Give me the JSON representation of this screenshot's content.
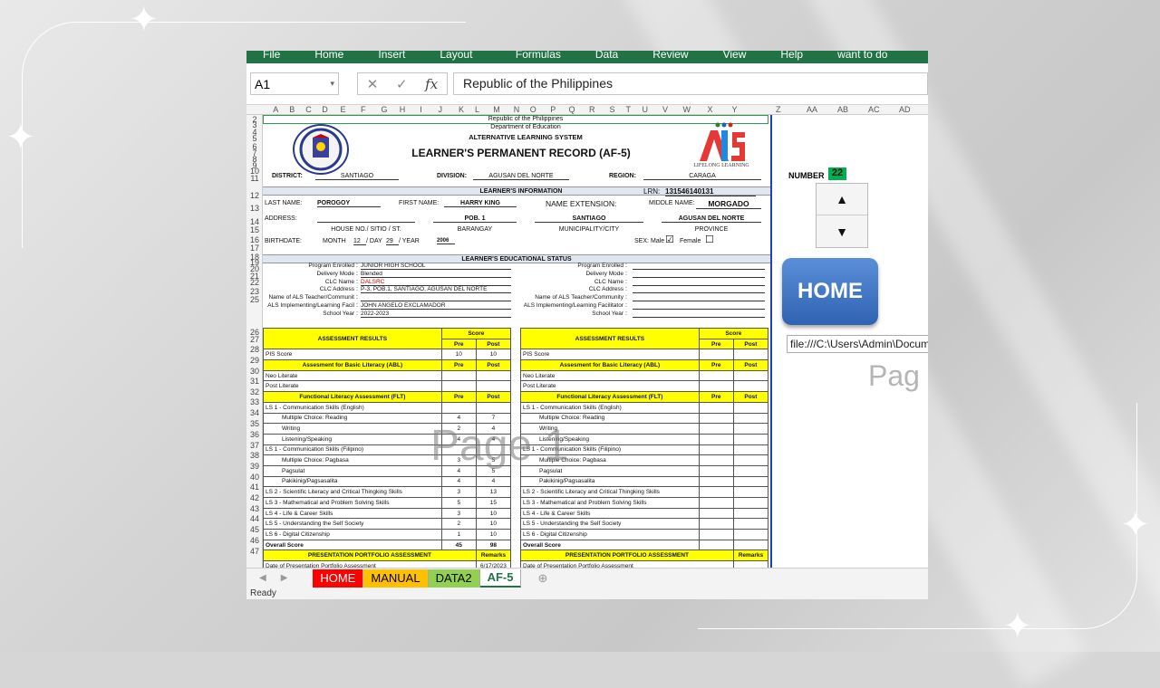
{
  "ribbon": {
    "tabs": [
      "File",
      "Home",
      "Insert",
      "Page Layout",
      "Formulas",
      "Data",
      "Review",
      "View",
      "Help",
      "Tell me what you want to do"
    ]
  },
  "formula_bar": {
    "name_box": "A1",
    "fx": "fx",
    "content": "Republic of the Philippines"
  },
  "columns": [
    "A",
    "B",
    "C",
    "D",
    "E",
    "F",
    "G",
    "H",
    "I",
    "J",
    "K",
    "L",
    "M",
    "N",
    "O",
    "P",
    "Q",
    "R",
    "S",
    "T",
    "U",
    "V",
    "W",
    "X",
    "Y",
    "Z",
    "AA",
    "AB",
    "AC",
    "AD",
    "AE"
  ],
  "rows": [
    "2",
    "3",
    "4",
    "5",
    "6",
    "7",
    "8",
    "9",
    "10",
    "11",
    "12",
    "13",
    "14",
    "15",
    "16",
    "17",
    "18",
    "19",
    "20",
    "21",
    "22",
    "23",
    "25",
    "26",
    "27",
    "28",
    "29",
    "30",
    "31",
    "32",
    "33",
    "34",
    "35",
    "36",
    "37",
    "38",
    "39",
    "40",
    "41",
    "42",
    "43",
    "44",
    "45",
    "46",
    "47"
  ],
  "header": {
    "republic": "Republic of the Philippines",
    "department": "Department of Education",
    "system": "ALTERNATIVE LEARNING SYSTEM",
    "title": "LEARNER'S PERMANENT RECORD (AF-5)",
    "als_logo": "ALS",
    "als_tagline": "LIFELONG LEARNING",
    "district_label": "DISTRICT:",
    "district": "SANTIAGO",
    "division_label": "DIVISION:",
    "division": "AGUSAN DEL NORTE",
    "region_label": "REGION:",
    "region": "CARAGA"
  },
  "learner_info": {
    "heading": "LEARNER'S INFORMATION",
    "lrn_label": "LRN:",
    "lrn": "131546140131",
    "last_name_label": "LAST NAME:",
    "last_name": "POROGOY",
    "first_name_label": "FIRST NAME:",
    "first_name": "HARRY KING",
    "ext_label": "NAME EXTENSION:",
    "middle_label": "MIDDLE NAME:",
    "middle_name": "MORGADO",
    "address_label": "ADDRESS:",
    "barangay": "POB. 1",
    "municipality": "SANTIAGO",
    "province": "AGUSAN DEL NORTE",
    "house_caption": "HOUSE NO./ SITIO / ST.",
    "barangay_caption": "BARANGAY",
    "municipality_caption": "MUNICIPALITY/CITY",
    "province_caption": "PROVINCE",
    "birthdate_label": "BIRTHDATE:",
    "month_label": "MONTH",
    "month": "12",
    "day_label": "/ DAY",
    "day": "29",
    "year_label": "/ YEAR",
    "year": "2006",
    "sex_label": "SEX:",
    "male_label": "Male",
    "female_label": "Female",
    "male_check": "☑",
    "female_check": "☐"
  },
  "educational_status": {
    "heading": "LEARNER'S EDUCATIONAL STATUS",
    "left": [
      {
        "label": "Program Enrolled",
        "value": "JUNIOR HIGH SCHOOL"
      },
      {
        "label": "Delivery Mode",
        "value": "Blended"
      },
      {
        "label": "CLC Name",
        "value": "DALSRC"
      },
      {
        "label": "CLC Address",
        "value": "P-3, POB.1, SANTIAGO, AGUSAN DEL NORTE"
      },
      {
        "label": "Name of ALS Teacher/Communit",
        "value": ""
      },
      {
        "label": "ALS Implementing/Learning Facil",
        "value": "JOHN ANGELO EXCLAMADOR"
      },
      {
        "label": "School Year",
        "value": "2022-2023"
      }
    ],
    "right": [
      {
        "label": "Program Enrolled",
        "value": ""
      },
      {
        "label": "Delivery Mode",
        "value": ""
      },
      {
        "label": "CLC Name",
        "value": ""
      },
      {
        "label": "CLC Address",
        "value": ""
      },
      {
        "label": "Name of ALS Teacher/Community",
        "value": ""
      },
      {
        "label": "ALS Implementing/Learning Facilitator",
        "value": ""
      },
      {
        "label": "School Year",
        "value": ""
      }
    ]
  },
  "assessment": {
    "heading": "ASSESSMENT RESULTS",
    "score": "Score",
    "pre": "Pre",
    "post": "Post",
    "left_rows": [
      {
        "label": "PIS Score",
        "pre": "10",
        "post": "10",
        "style": "plain"
      },
      {
        "label": "Assesment for Basic Literacy (ABL)",
        "pre": "Pre",
        "post": "Post",
        "style": "yellow"
      },
      {
        "label": "Neo Literate",
        "pre": "",
        "post": "",
        "style": "plain"
      },
      {
        "label": "Post Literate",
        "pre": "",
        "post": "",
        "style": "plain"
      },
      {
        "label": "Functional Literacy Assessment (FLT)",
        "pre": "Pre",
        "post": "Post",
        "style": "yellow"
      },
      {
        "label": "LS 1 - Communication Skills (English)",
        "pre": "",
        "post": "",
        "style": "plain"
      },
      {
        "label": "Multiple Choice: Reading",
        "pre": "4",
        "post": "7",
        "style": "indent"
      },
      {
        "label": "Writing",
        "pre": "2",
        "post": "4",
        "style": "indent"
      },
      {
        "label": "Listening/Speaking",
        "pre": "4",
        "post": "4",
        "style": "indent"
      },
      {
        "label": "LS 1 - Communication Skills (Filipino)",
        "pre": "",
        "post": "",
        "style": "plain"
      },
      {
        "label": "Multiple Choice: Pagbasa",
        "pre": "3",
        "post": "5",
        "style": "indent"
      },
      {
        "label": "Pagsulat",
        "pre": "4",
        "post": "5",
        "style": "indent"
      },
      {
        "label": "Pakikinig/Pagsasalita",
        "pre": "4",
        "post": "4",
        "style": "indent"
      },
      {
        "label": "LS 2 - Scientific Literacy and Critical Thingking Skills",
        "pre": "3",
        "post": "13",
        "style": "plain"
      },
      {
        "label": "LS 3 - Mathematical and Problem Solving Skills",
        "pre": "5",
        "post": "15",
        "style": "plain"
      },
      {
        "label": "LS 4 - Life & Career Skills",
        "pre": "3",
        "post": "10",
        "style": "plain"
      },
      {
        "label": "LS 5 - Understanding the Self Society",
        "pre": "2",
        "post": "10",
        "style": "plain"
      },
      {
        "label": "LS 6 - Digital Citizenship",
        "pre": "1",
        "post": "10",
        "style": "plain"
      },
      {
        "label": "Overall Score",
        "pre": "45",
        "post": "98",
        "style": "bold"
      },
      {
        "label": "PRESENTATION PORTFOLIO ASSESSMENT",
        "pre": "Remarks",
        "post": "",
        "style": "yellow-span"
      },
      {
        "label": "Date of Presentation Portfolio Assessment",
        "pre": "6/17/2023",
        "post": "",
        "style": "plain-span"
      }
    ],
    "right_rows": [
      {
        "label": "PIS Score",
        "pre": "",
        "post": "",
        "style": "plain"
      },
      {
        "label": "Assesment for Basic Literacy (ABL)",
        "pre": "Pre",
        "post": "Post",
        "style": "yellow"
      },
      {
        "label": "Neo Literate",
        "pre": "",
        "post": "",
        "style": "plain"
      },
      {
        "label": "Post Literate",
        "pre": "",
        "post": "",
        "style": "plain"
      },
      {
        "label": "Functional Literacy Assessment (FLT)",
        "pre": "Pre",
        "post": "Post",
        "style": "yellow"
      },
      {
        "label": "LS 1 - Communication Skills (English)",
        "pre": "",
        "post": "",
        "style": "plain"
      },
      {
        "label": "Multiple Choice: Reading",
        "pre": "",
        "post": "",
        "style": "indent"
      },
      {
        "label": "Writing",
        "pre": "",
        "post": "",
        "style": "indent"
      },
      {
        "label": "Listening/Speaking",
        "pre": "",
        "post": "",
        "style": "indent"
      },
      {
        "label": "LS 1 - Communication Skills (Filipino)",
        "pre": "",
        "post": "",
        "style": "plain"
      },
      {
        "label": "Multiple Choice: Pagbasa",
        "pre": "",
        "post": "",
        "style": "indent"
      },
      {
        "label": "Pagsulat",
        "pre": "",
        "post": "",
        "style": "indent"
      },
      {
        "label": "Pakikinig/Pagsasalita",
        "pre": "",
        "post": "",
        "style": "indent"
      },
      {
        "label": "LS 2 - Scientific Literacy and Critical Thingking Skills",
        "pre": "",
        "post": "",
        "style": "plain"
      },
      {
        "label": "LS 3 - Mathematical and Problem Solving Skills",
        "pre": "",
        "post": "",
        "style": "plain"
      },
      {
        "label": "LS 4 - Life & Career Skills",
        "pre": "",
        "post": "",
        "style": "plain"
      },
      {
        "label": "LS 5 - Understanding the Self Society",
        "pre": "",
        "post": "",
        "style": "plain"
      },
      {
        "label": "LS 6 - Digital Citizenship",
        "pre": "",
        "post": "",
        "style": "plain"
      },
      {
        "label": "Overall Score",
        "pre": "",
        "post": "",
        "style": "bold"
      },
      {
        "label": "PRESENTATION PORTFOLIO ASSESSMENT",
        "pre": "Remarks",
        "post": "",
        "style": "yellow-span"
      },
      {
        "label": "Date of Presentation Portfolio Assessment",
        "pre": "",
        "post": "",
        "style": "plain-span"
      }
    ]
  },
  "watermark": {
    "page1": "Page 1",
    "page2": "Pag"
  },
  "right_panel": {
    "number_label": "NUMBER",
    "number": "22",
    "home_button": "HOME",
    "path": "file:///C:\\Users\\Admin\\Docum"
  },
  "sheet_tabs": [
    {
      "label": "HOME",
      "bg": "#ff0000",
      "fg": "#ffffff"
    },
    {
      "label": "MANUAL",
      "bg": "#ffc000",
      "fg": "#000000"
    },
    {
      "label": "DATA2",
      "bg": "#92d050",
      "fg": "#000000"
    },
    {
      "label": "AF-5",
      "bg": "#ffffff",
      "fg": "#217346"
    }
  ],
  "status": "Ready",
  "colors": {
    "excel_green": "#217346",
    "yellow": "#ffff00",
    "home_blue": "#2f63b3",
    "number_green": "#00b050"
  }
}
